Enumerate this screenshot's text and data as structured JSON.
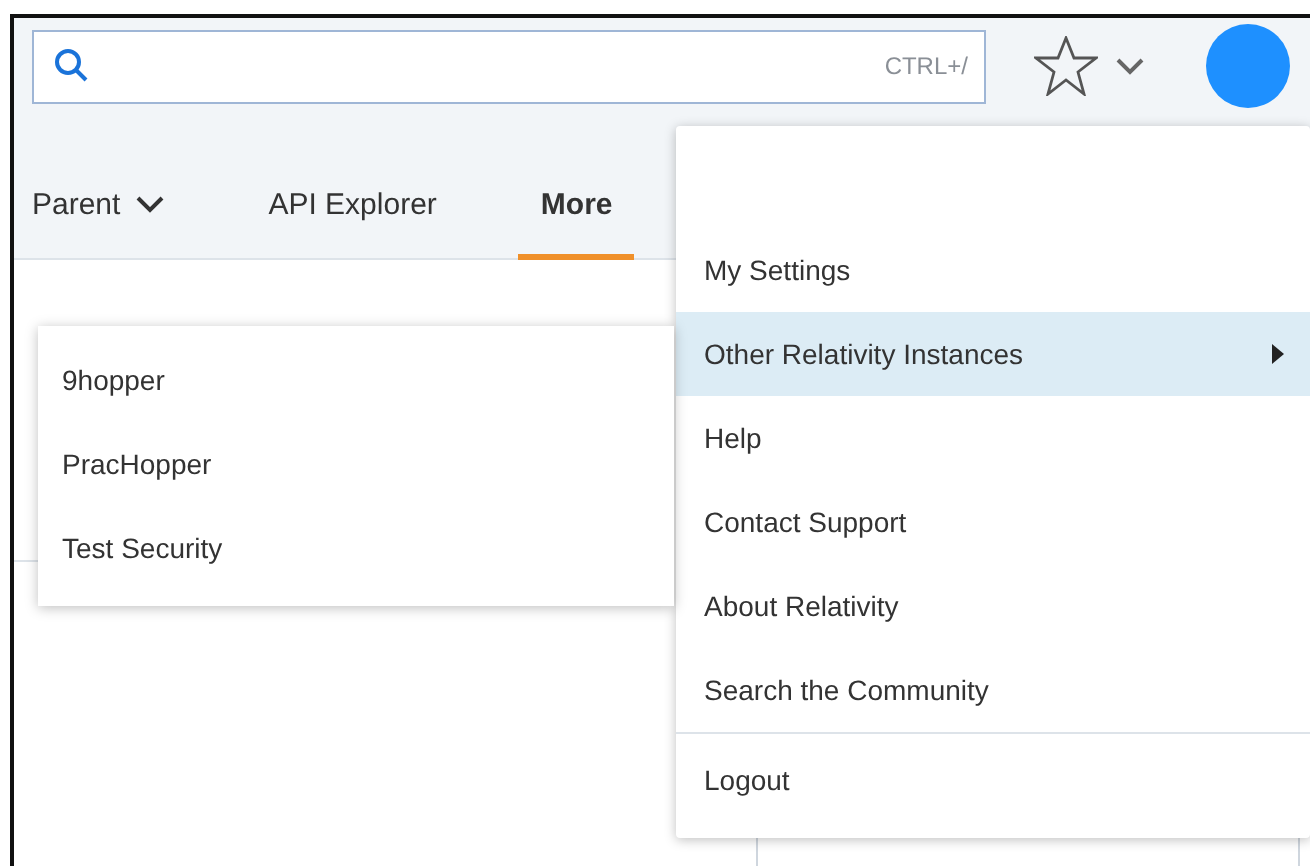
{
  "search": {
    "shortcut": "CTRL+/"
  },
  "tabs": [
    {
      "label": "Parent",
      "selected": false,
      "has_dropdown": true
    },
    {
      "label": "API Explorer",
      "selected": false,
      "has_dropdown": false
    },
    {
      "label": "More",
      "selected": true,
      "has_dropdown": false
    }
  ],
  "user_menu": [
    {
      "label": "My Settings",
      "highlighted": false,
      "has_submenu": false,
      "divider_before": false
    },
    {
      "label": "Other Relativity Instances",
      "highlighted": true,
      "has_submenu": true,
      "divider_before": false
    },
    {
      "label": "Help",
      "highlighted": false,
      "has_submenu": false,
      "divider_before": false
    },
    {
      "label": "Contact Support",
      "highlighted": false,
      "has_submenu": false,
      "divider_before": false
    },
    {
      "label": "About Relativity",
      "highlighted": false,
      "has_submenu": false,
      "divider_before": false
    },
    {
      "label": "Search the Community",
      "highlighted": false,
      "has_submenu": false,
      "divider_before": false
    },
    {
      "label": "Logout",
      "highlighted": false,
      "has_submenu": false,
      "divider_before": true
    }
  ],
  "submenu": [
    {
      "label": "9hopper"
    },
    {
      "label": "PracHopper"
    },
    {
      "label": "Test Security"
    }
  ]
}
